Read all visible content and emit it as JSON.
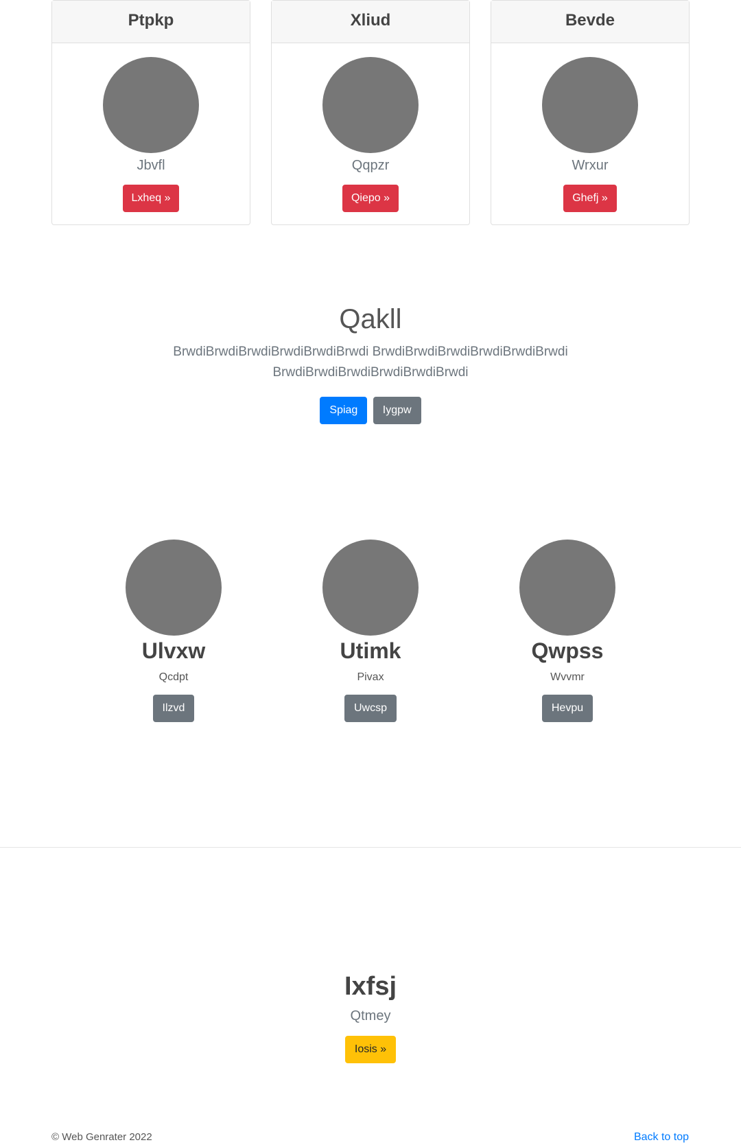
{
  "cards": [
    {
      "title": "Ptpkp",
      "subtitle": "Jbvfl",
      "button": "Lxheq »"
    },
    {
      "title": "Xliud",
      "subtitle": "Qqpzr",
      "button": "Qiepo »"
    },
    {
      "title": "Bevde",
      "subtitle": "Wrxur",
      "button": "Ghefj »"
    }
  ],
  "hero": {
    "title": "Qakll",
    "lead": "BrwdiBrwdiBrwdiBrwdiBrwdiBrwdi BrwdiBrwdiBrwdiBrwdiBrwdiBrwdi BrwdiBrwdiBrwdiBrwdiBrwdiBrwdi",
    "primary_button": "Spiag",
    "secondary_button": "Iygpw"
  },
  "columns": [
    {
      "title": "Ulvxw",
      "subtitle": "Qcdpt",
      "button": "Ilzvd"
    },
    {
      "title": "Utimk",
      "subtitle": "Pivax",
      "button": "Uwcsp"
    },
    {
      "title": "Qwpss",
      "subtitle": "Wvvmr",
      "button": "Hevpu"
    }
  ],
  "cta": {
    "title": "Ixfsj",
    "subtitle": "Qtmey",
    "button": "Iosis »"
  },
  "footer": {
    "copyright": "© Web Genrater 2022",
    "back_to_top": "Back to top"
  },
  "colors": {
    "danger": "#dc3545",
    "primary": "#007bff",
    "secondary": "#6c757d",
    "warning": "#ffc107",
    "placeholder_image": "#777777"
  }
}
